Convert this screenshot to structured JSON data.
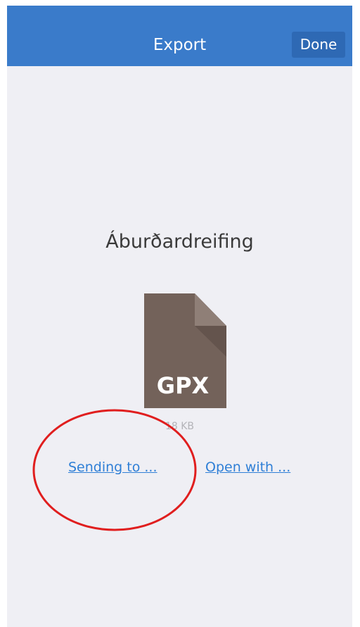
{
  "navbar": {
    "title": "Export",
    "done_label": "Done",
    "color": "#3a7bca"
  },
  "file": {
    "name": "Áburðardreifing",
    "type_label": "GPX",
    "size": "18 KB",
    "icon": "gpx-file-icon",
    "icon_color": "#73625a"
  },
  "actions": {
    "send_label": "Sending to ...",
    "open_label": "Open with ..."
  },
  "annotation": {
    "shape": "ellipse",
    "color": "#e01e1e",
    "target": "Sending to ..."
  }
}
